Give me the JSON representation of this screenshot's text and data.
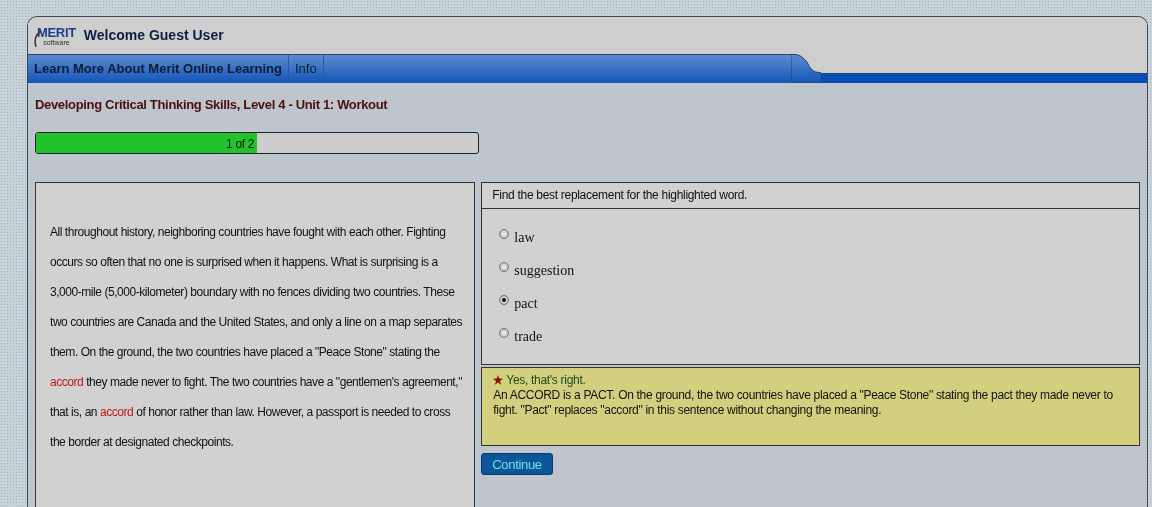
{
  "header": {
    "logo": {
      "name": "MERIT",
      "tagline": "software"
    },
    "welcome": "Welcome Guest User"
  },
  "nav": [
    {
      "label": "Learn More About Merit Online Learning",
      "selected": true
    },
    {
      "label": "Info",
      "selected": false
    }
  ],
  "lesson_title": "Developing Critical Thinking Skills, Level 4 - Unit 1: Workout",
  "progress": {
    "label": "1 of 2",
    "level": 0.5
  },
  "passage": [
    {
      "text": "All throughout history, neighboring countries have fought with each other. Fighting occurs so often that no one is surprised when it happens. What is surprising is a 3,000-mile (5,000-kilometer) boundary with no fences dividing two countries. These two countries are Canada and the United States, and only a line on a map separates them. On the ground, the two countries have placed a \"Peace Stone\" stating the ",
      "highlighted": false
    },
    {
      "text": "accord",
      "highlighted": true
    },
    {
      "text": " they made never to fight. The two countries have a \"gentlemen's agreement,\" that is, an ",
      "highlighted": false
    },
    {
      "text": "accord",
      "highlighted": true
    },
    {
      "text": " of honor rather than law. However, a passport is needed to cross the border at designated checkpoints.",
      "highlighted": false
    }
  ],
  "question": {
    "prompt": "Find the best replacement for the highlighted word.",
    "options": [
      {
        "label": "law",
        "selected": false
      },
      {
        "label": "suggestion",
        "selected": false
      },
      {
        "label": "pact",
        "selected": true
      },
      {
        "label": "trade",
        "selected": false
      }
    ]
  },
  "feedback": {
    "correct": true,
    "headline": "Yes, that's right.",
    "text": "An ACCORD is a PACT. On the ground, the two countries have placed a \"Peace Stone\" stating the pact they made never to fight. \"Pact\" replaces \"accord\" in this sentence without changing the meaning."
  },
  "continue_button": "Continue"
}
